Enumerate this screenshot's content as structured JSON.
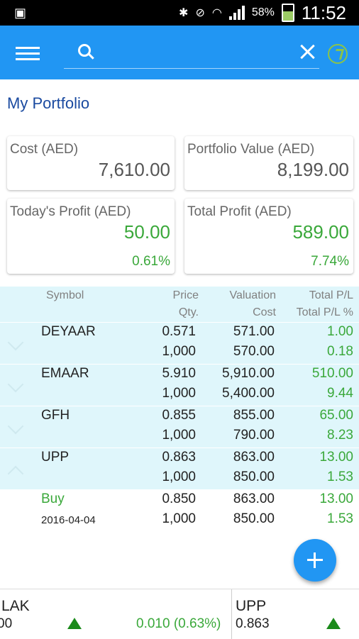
{
  "status_bar": {
    "battery": "58%",
    "time": "11:52"
  },
  "page_title": "My Portfolio",
  "summary": {
    "cost": {
      "label": "Cost (AED)",
      "value": "7,610.00"
    },
    "portfolio_value": {
      "label": "Portfolio Value (AED)",
      "value": "8,199.00"
    },
    "todays_profit": {
      "label": "Today's Profit (AED)",
      "value": "50.00",
      "pct": "0.61%"
    },
    "total_profit": {
      "label": "Total Profit (AED)",
      "value": "589.00",
      "pct": "7.74%"
    }
  },
  "table": {
    "headers": {
      "symbol": "Symbol",
      "price": "Price",
      "qty": "Qty.",
      "valuation": "Valuation",
      "cost": "Cost",
      "total_pl": "Total P/L",
      "total_pl_pct": "Total P/L %"
    },
    "rows": [
      {
        "symbol": "DEYAAR",
        "price": "0.571",
        "qty": "1,000",
        "valuation": "571.00",
        "cost": "570.00",
        "total_pl": "1.00",
        "total_pl_pct": "0.18"
      },
      {
        "symbol": "EMAAR",
        "price": "5.910",
        "qty": "1,000",
        "valuation": "5,910.00",
        "cost": "5,400.00",
        "total_pl": "510.00",
        "total_pl_pct": "9.44"
      },
      {
        "symbol": "GFH",
        "price": "0.855",
        "qty": "1,000",
        "valuation": "855.00",
        "cost": "790.00",
        "total_pl": "65.00",
        "total_pl_pct": "8.23"
      },
      {
        "symbol": "UPP",
        "price": "0.863",
        "qty": "1,000",
        "valuation": "863.00",
        "cost": "850.00",
        "total_pl": "13.00",
        "total_pl_pct": "1.53"
      }
    ],
    "expanded": {
      "type": "Buy",
      "date": "2016-04-04",
      "price": "0.850",
      "qty": "1,000",
      "valuation": "863.00",
      "cost": "850.00",
      "total_pl": "13.00",
      "total_pl_pct": "1.53"
    }
  },
  "ticker": {
    "item1": {
      "symbol": "LAK",
      "price": "00",
      "change": "0.010 (0.63%)"
    },
    "item2": {
      "symbol": "UPP",
      "price": "0.863"
    }
  },
  "colors": {
    "accent": "#2196f3",
    "positive": "#3aa83a",
    "row_bg": "#dff6fb",
    "title": "#1a4aa0"
  }
}
